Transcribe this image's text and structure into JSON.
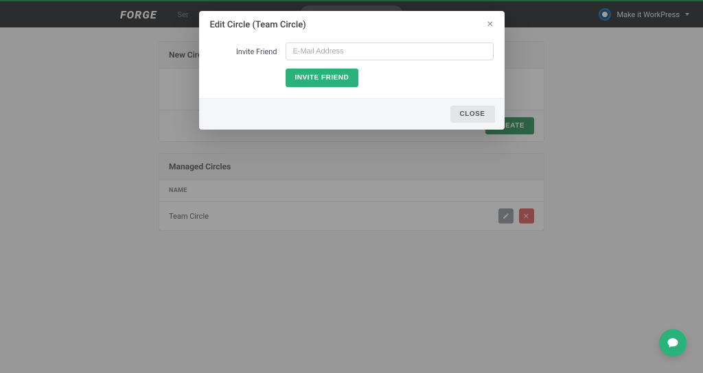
{
  "nav": {
    "logo": "FORGE",
    "left_text": "Ser",
    "team_name": "Make it WorkPress"
  },
  "cards": {
    "new_circle": {
      "title": "New Circle",
      "create_label": "CREATE"
    },
    "managed": {
      "title": "Managed Circles",
      "col_name": "NAME",
      "rows": [
        {
          "name": "Team Circle"
        }
      ]
    }
  },
  "modal": {
    "title": "Edit Circle (Team Circle)",
    "invite_label": "Invite Friend",
    "email_placeholder": "E-Mail Address",
    "invite_button": "INVITE FRIEND",
    "close_button": "CLOSE"
  }
}
